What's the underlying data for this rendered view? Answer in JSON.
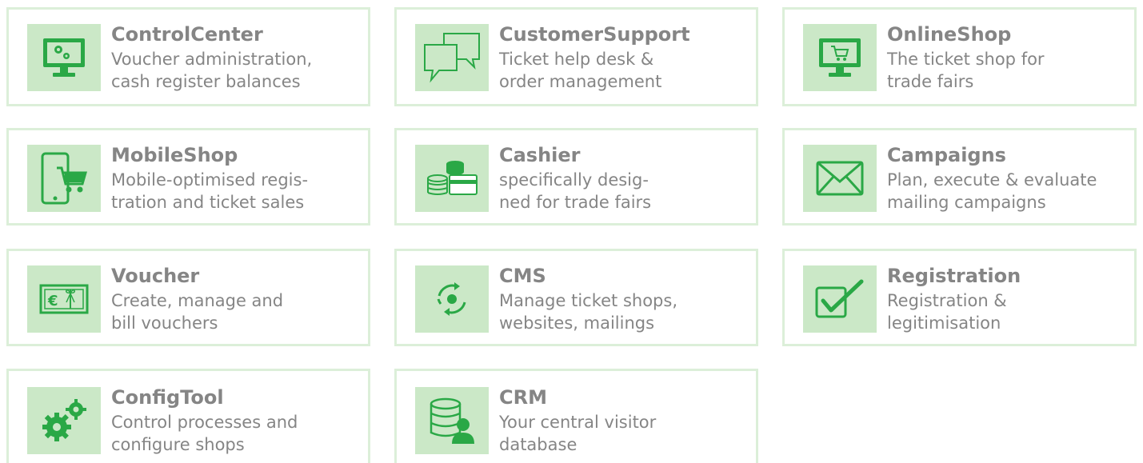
{
  "colors": {
    "border": "#dcefd9",
    "icon_bg": "#cbe8c7",
    "icon_green": "#2aa846",
    "text_gray": "#858585"
  },
  "cards": [
    {
      "title": "ControlCenter",
      "description": "Voucher administration,\ncash register balances",
      "icon": "monitor-gears-icon"
    },
    {
      "title": "CustomerSupport",
      "description": "Ticket help desk &\norder management",
      "icon": "speech-bubbles-icon"
    },
    {
      "title": "OnlineShop",
      "description": "The ticket shop for\ntrade fairs",
      "icon": "monitor-cart-icon"
    },
    {
      "title": "MobileShop",
      "description": "Mobile-optimised regis-\ntration and ticket sales",
      "icon": "phone-cart-icon"
    },
    {
      "title": "Cashier",
      "description": "specifically desig-\nned for trade fairs",
      "icon": "coins-card-icon"
    },
    {
      "title": "Campaigns",
      "description": "Plan, execute & evaluate\nmailing campaigns",
      "icon": "envelope-icon"
    },
    {
      "title": "Voucher",
      "description": "Create, manage and\nbill vouchers",
      "icon": "voucher-gift-icon"
    },
    {
      "title": "CMS",
      "description": "Manage ticket shops,\nwebsites, mailings",
      "icon": "refresh-circle-icon"
    },
    {
      "title": "Registration",
      "description": "Registration &\nlegitimisation",
      "icon": "checkbox-check-icon"
    },
    {
      "title": "ConfigTool",
      "description": "Control processes and\nconfigure shops",
      "icon": "gears-icon"
    },
    {
      "title": "CRM",
      "description": "Your central visitor\ndatabase",
      "icon": "database-person-icon"
    }
  ]
}
